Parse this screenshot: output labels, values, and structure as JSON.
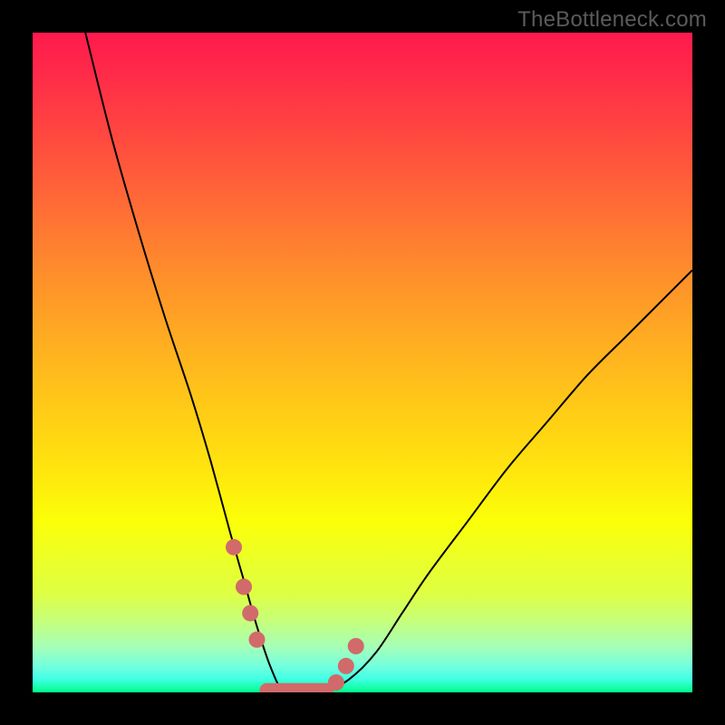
{
  "watermark": "TheBottleneck.com",
  "colors": {
    "background": "#000000",
    "curve": "#000000",
    "marker": "#d16a6a",
    "gradient_stops": [
      "#ff1a4d",
      "#ff2a49",
      "#ff4640",
      "#ff6b36",
      "#ff8c2c",
      "#ffab22",
      "#ffc818",
      "#ffe40e",
      "#fbff08",
      "#ebff29",
      "#deff43",
      "#c7ff78",
      "#a6ffb6",
      "#74ffde",
      "#40ffe4",
      "#00ff88"
    ]
  },
  "chart_data": {
    "type": "line",
    "title": "",
    "xlabel": "",
    "ylabel": "",
    "xlim": [
      0,
      100
    ],
    "ylim": [
      0,
      100
    ],
    "series": [
      {
        "name": "bottleneck-curve",
        "x": [
          8,
          12,
          16,
          20,
          24,
          27,
          30,
          32,
          34,
          36,
          38,
          40,
          44,
          48,
          52,
          56,
          60,
          66,
          72,
          78,
          84,
          90,
          96,
          100
        ],
        "y": [
          100,
          84,
          70,
          57,
          45,
          35,
          24,
          17,
          10,
          4,
          0,
          0,
          0,
          2,
          6,
          12,
          18,
          26,
          34,
          41,
          48,
          54,
          60,
          64
        ]
      }
    ],
    "markers": {
      "name": "highlight-points",
      "x": [
        30.5,
        32.0,
        33.0,
        34.0,
        46.0,
        47.5,
        49.0
      ],
      "y": [
        22.0,
        16.0,
        12.0,
        8.0,
        1.5,
        4.0,
        7.0
      ]
    },
    "flat_segment": {
      "x0": 35.5,
      "x1": 44.5,
      "y": 0.3
    }
  }
}
